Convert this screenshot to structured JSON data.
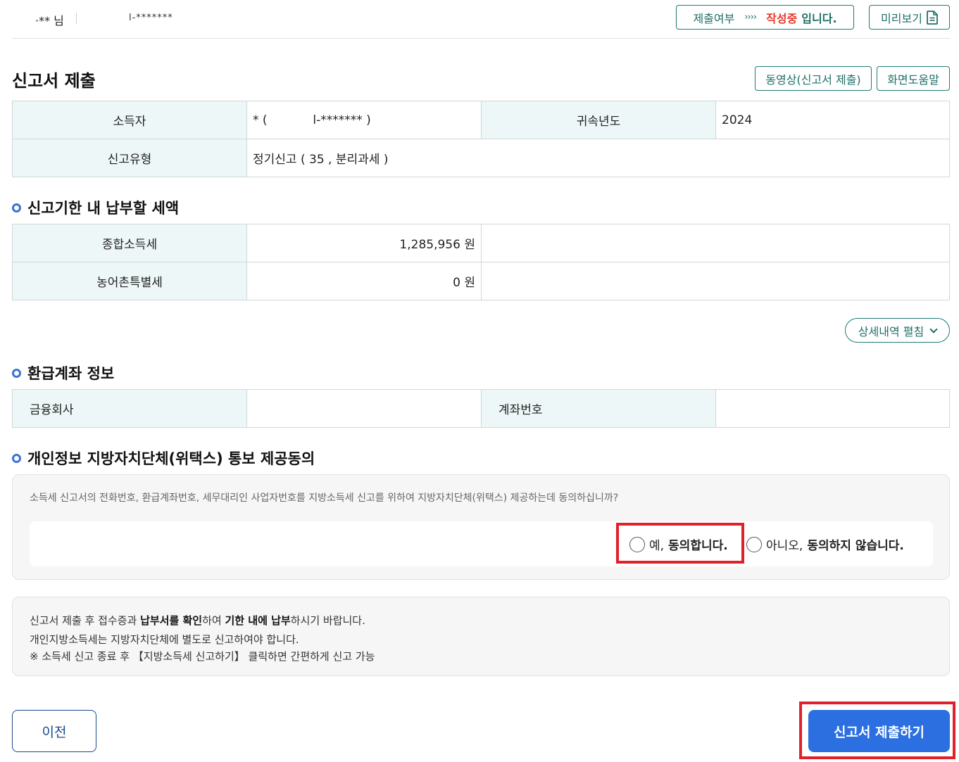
{
  "header": {
    "user_name": "·** 님",
    "user_id": "l-*******",
    "status_prefix": "제출여부",
    "status_arrows": "››››",
    "status_state": "작성중",
    "status_suffix": "입니다.",
    "preview_label": "미리보기",
    "preview_icon": "document-icon"
  },
  "page": {
    "title": "신고서 제출",
    "video_label": "동영상(신고서 제출)",
    "help_label": "화면도움말"
  },
  "filer_table": {
    "filer_header": "소득자",
    "filer_value": "* (            l-******* )",
    "year_header": "귀속년도",
    "year_value": "2024",
    "type_header": "신고유형",
    "type_value": "정기신고 ( 35 , 분리과세 )"
  },
  "tax_section": {
    "title": "신고기한 내 납부할 세액",
    "rows": [
      {
        "label": "종합소득세",
        "amount": "1,285,956 원"
      },
      {
        "label": "농어촌특별세",
        "amount": "0 원"
      }
    ],
    "detail_label": "상세내역 펼침"
  },
  "refund_section": {
    "title": "환급계좌 정보",
    "bank_header": "금융회사",
    "bank_value": "",
    "account_header": "계좌번호",
    "account_value": ""
  },
  "consent_section": {
    "title": "개인정보 지방자치단체(위택스) 통보 제공동의",
    "question": "소득세 신고서의 전화번호, 환급계좌번호, 세무대리인 사업자번호를 지방소득세 신고를 위하여 지방자치단체(위택스) 제공하는데 동의하십니까?",
    "yes_prefix": "예,",
    "yes_bold": "동의합니다.",
    "no_prefix": "아니오,",
    "no_bold": "동의하지 않습니다."
  },
  "info_box": {
    "line1_a": "신고서 제출 후 접수증과 ",
    "line1_b": "납부서를 확인",
    "line1_c": "하여 ",
    "line1_d": "기한 내에 납부",
    "line1_e": "하시기 바랍니다.",
    "line2": "개인지방소득세는 지방자치단체에 별도로 신고하여야 합니다.",
    "line3": "※ 소득세 신고 종료 후 【지방소득세 신고하기】 클릭하면 간편하게 신고 가능"
  },
  "footer": {
    "prev_label": "이전",
    "submit_label": "신고서 제출하기"
  },
  "colors": {
    "accent_teal": "#1e7b74",
    "primary_blue": "#2b6fe0",
    "highlight_red": "#e0202a",
    "status_red": "#e8382c"
  }
}
